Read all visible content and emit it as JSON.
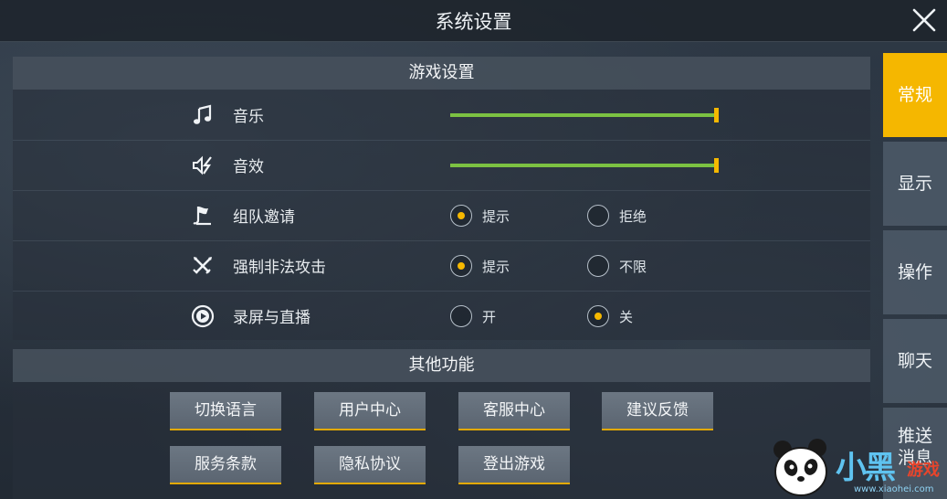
{
  "header": {
    "title": "系统设置"
  },
  "sections": {
    "game_settings": "游戏设置",
    "other_functions": "其他功能"
  },
  "settings": {
    "music": {
      "label": "音乐",
      "level": 1.0
    },
    "sound": {
      "label": "音效",
      "level": 1.0
    },
    "team_invite": {
      "label": "组队邀请",
      "options": [
        "提示",
        "拒绝"
      ],
      "selected": "提示"
    },
    "force_attack": {
      "label": "强制非法攻击",
      "options": [
        "提示",
        "不限"
      ],
      "selected": "提示"
    },
    "record_stream": {
      "label": "录屏与直播",
      "options": [
        "开",
        "关"
      ],
      "selected": "关"
    }
  },
  "functions": {
    "switch_language": "切换语言",
    "user_center": "用户中心",
    "customer_service": "客服中心",
    "feedback": "建议反馈",
    "terms": "服务条款",
    "privacy": "隐私协议",
    "logout": "登出游戏"
  },
  "tabs": [
    {
      "label": "常规",
      "active": true
    },
    {
      "label": "显示",
      "active": false
    },
    {
      "label": "操作",
      "active": false
    },
    {
      "label": "聊天",
      "active": false
    },
    {
      "label": "推送\n消息",
      "active": false
    }
  ],
  "watermark": {
    "brand": "小黑",
    "suffix": "游戏",
    "url": "www.xiaohei.com"
  },
  "colors": {
    "accent": "#f5b700",
    "slider_fill": "#7cc242"
  }
}
